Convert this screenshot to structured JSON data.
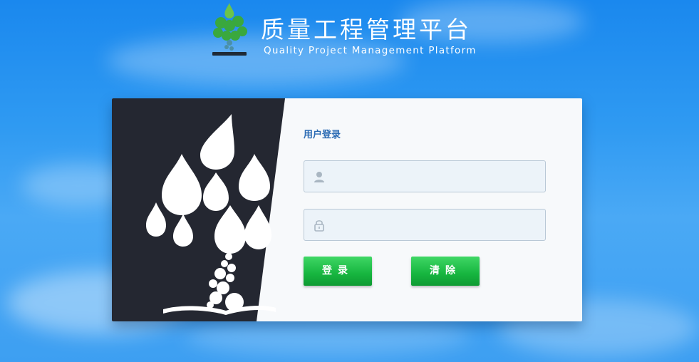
{
  "header": {
    "title_zh": "质量工程管理平台",
    "title_en": "Quality Project Management Platform",
    "logo_icon": "tree-logo-icon"
  },
  "login": {
    "title": "用户登录",
    "username": {
      "value": "",
      "placeholder": "",
      "icon": "user-icon"
    },
    "password": {
      "value": "",
      "placeholder": "",
      "icon": "lock-icon"
    },
    "login_label": "登录",
    "clear_label": "清除"
  },
  "colors": {
    "background": "#2f9af2",
    "panel_dark": "#242731",
    "accent_green": "#16b53f",
    "title_blue": "#2a6ab3"
  }
}
